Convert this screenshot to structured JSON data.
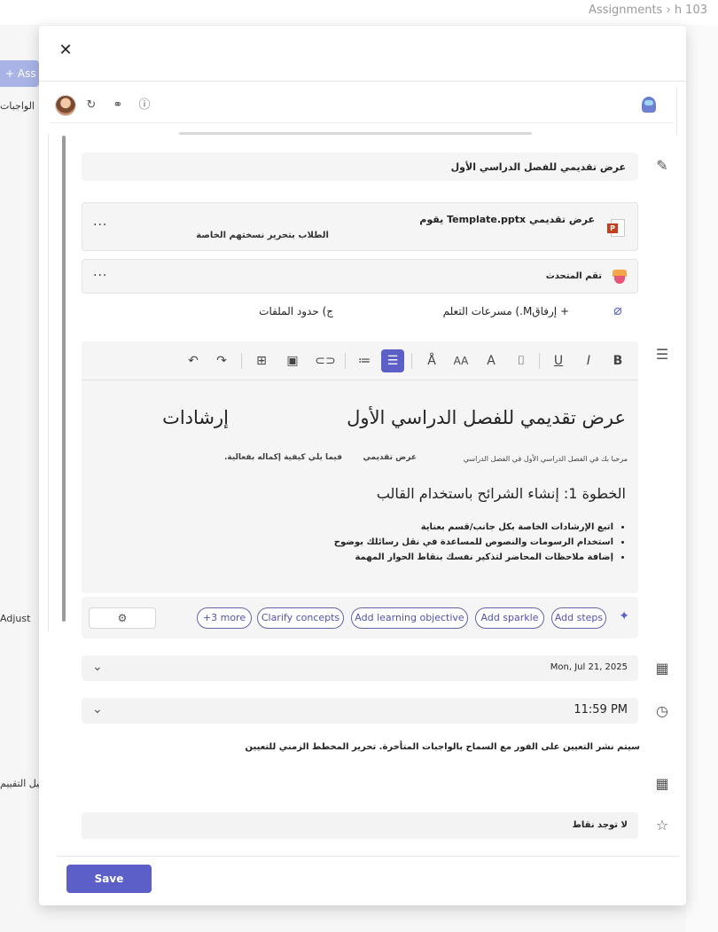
{
  "background": {
    "breadcrumb_prefix": "h 103",
    "breadcrumb_sep": "›",
    "breadcrumb_current": "Assignments",
    "add_label": "+ Ass",
    "left_label_1": "الواجبات",
    "left_label_2": "Adjust",
    "left_label_3": "إضافة دليل التقييم"
  },
  "dialog": {
    "close_glyph": "✕",
    "title": "عرض تقديمي للفصل الدراسي الأول",
    "attachment": {
      "name": "عرض تقديمي Template.pptx يقوم",
      "subtitle": "الطلاب بتحرير نسختهم الخاصة",
      "more": "···"
    },
    "speech": {
      "name": "تقم المتحدث",
      "more": "···"
    },
    "attach_row": {
      "attach": "+ إرفاقM.) مسرعات التعلم",
      "limits": "ج) حدود الملفات"
    },
    "editor": {
      "heading": "عرض تقديمي للفصل الدراسي الأول",
      "heading2": "إرشادات",
      "intro": "مرحبا بك في الفصل الدراسي الأول في الفصل الدراسي",
      "intro_bold": "عرض تقديمي",
      "intro_end": "فيما يلي كيفية إكماله بفعالية.",
      "step_heading": "الخطوة 1: إنشاء الشرائح باستخدام القالب",
      "steps": [
        "اتبع الإرشادات الخاصة بكل جانب/قسم بعناية",
        "استخدام الرسومات والنصوص للمساعدة في نقل رسائلك بوضوح",
        "إضافة ملاحظات المحاضر لتذكير نفسك بنقاط الحوار المهمة"
      ]
    },
    "ai_chips": [
      "Add steps",
      "Add sparkle",
      "Add learning objective",
      "Clarify concepts",
      "+3 more"
    ],
    "due_date": "Mon, Jul 21, 2025",
    "due_time": "11:59 PM",
    "schedule_text": "سيتم نشر التعيين على الفور مع السماح بالواجبات المتأخرة. تحرير المخطط الزمني للتعيين",
    "points": "لا توجد نقاط",
    "save_label": "Save"
  },
  "icons": {
    "pencil": "✎",
    "instructions": "☰",
    "calendar": "▦",
    "clock": "◷",
    "rubric": "▦",
    "star": "☆",
    "paperclip": "⌀",
    "sync": "↻",
    "share": "⚭",
    "info": "ⓘ",
    "sparkle": "✦",
    "filter": "⚙",
    "chevron": "⌄"
  }
}
